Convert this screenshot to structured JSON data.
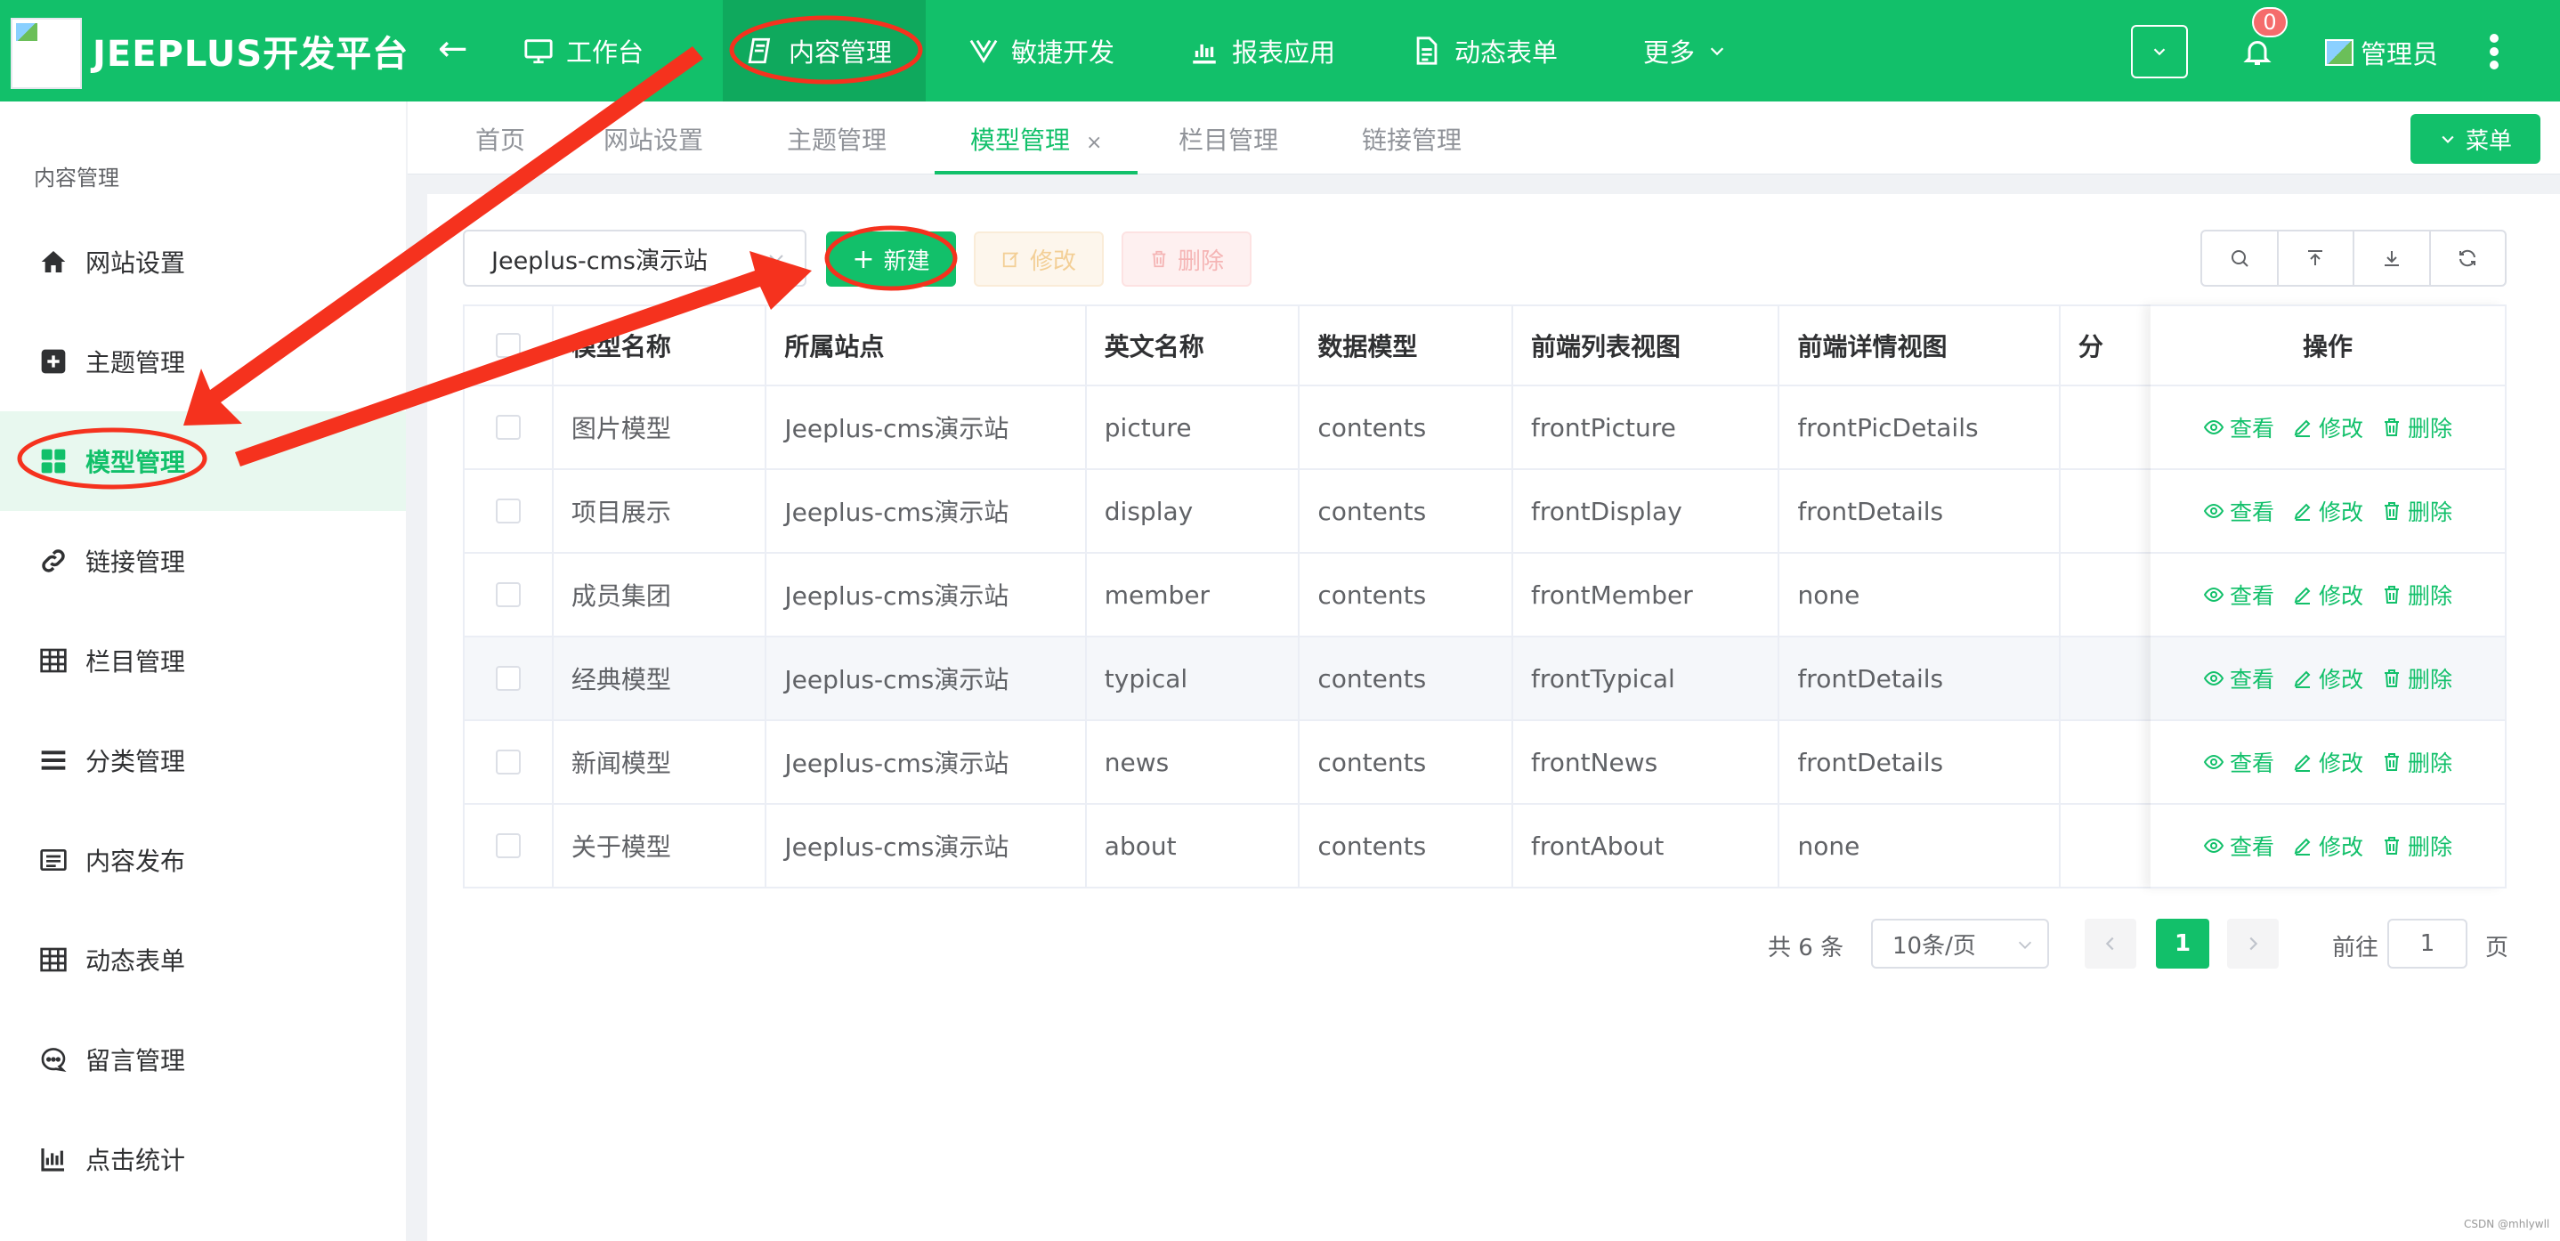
{
  "header": {
    "brand": "JEEPLUS开发平台",
    "nav": [
      {
        "label": "工作台"
      },
      {
        "label": "内容管理"
      },
      {
        "label": "敏捷开发"
      },
      {
        "label": "报表应用"
      },
      {
        "label": "动态表单"
      },
      {
        "label": "更多"
      }
    ],
    "notification_count": "0",
    "user_name": "管理员"
  },
  "sidebar": {
    "title": "内容管理",
    "items": [
      {
        "label": "网站设置",
        "icon": "home-icon"
      },
      {
        "label": "主题管理",
        "icon": "plus-square-icon"
      },
      {
        "label": "模型管理",
        "icon": "grid-icon"
      },
      {
        "label": "链接管理",
        "icon": "link-icon"
      },
      {
        "label": "栏目管理",
        "icon": "table-icon"
      },
      {
        "label": "分类管理",
        "icon": "list-icon"
      },
      {
        "label": "内容发布",
        "icon": "document-list-icon"
      },
      {
        "label": "动态表单",
        "icon": "table-icon"
      },
      {
        "label": "留言管理",
        "icon": "chat-icon"
      },
      {
        "label": "点击统计",
        "icon": "bar-chart-icon"
      }
    ]
  },
  "tabs": [
    {
      "label": "首页"
    },
    {
      "label": "网站设置"
    },
    {
      "label": "主题管理"
    },
    {
      "label": "模型管理"
    },
    {
      "label": "栏目管理"
    },
    {
      "label": "链接管理"
    }
  ],
  "tab_close": "×",
  "menu_button": "菜单",
  "toolbar": {
    "site_select": "Jeeplus-cms演示站",
    "new": "新建",
    "edit": "修改",
    "delete": "删除"
  },
  "table": {
    "columns": [
      "模型名称",
      "所属站点",
      "英文名称",
      "数据模型",
      "前端列表视图",
      "前端详情视图",
      "分"
    ],
    "ops_header": "操作",
    "ops": {
      "view": "查看",
      "edit": "修改",
      "delete": "删除"
    },
    "rows": [
      {
        "name": "图片模型",
        "site": "Jeeplus-cms演示站",
        "en": "picture",
        "model": "contents",
        "list_view": "frontPicture",
        "detail_view": "frontPicDetails"
      },
      {
        "name": "项目展示",
        "site": "Jeeplus-cms演示站",
        "en": "display",
        "model": "contents",
        "list_view": "frontDisplay",
        "detail_view": "frontDetails"
      },
      {
        "name": "成员集团",
        "site": "Jeeplus-cms演示站",
        "en": "member",
        "model": "contents",
        "list_view": "frontMember",
        "detail_view": "none"
      },
      {
        "name": "经典模型",
        "site": "Jeeplus-cms演示站",
        "en": "typical",
        "model": "contents",
        "list_view": "frontTypical",
        "detail_view": "frontDetails"
      },
      {
        "name": "新闻模型",
        "site": "Jeeplus-cms演示站",
        "en": "news",
        "model": "contents",
        "list_view": "frontNews",
        "detail_view": "frontDetails"
      },
      {
        "name": "关于模型",
        "site": "Jeeplus-cms演示站",
        "en": "about",
        "model": "contents",
        "list_view": "frontAbout",
        "detail_view": "none"
      }
    ]
  },
  "pagination": {
    "total": "共 6 条",
    "page_size": "10条/页",
    "current_page": "1",
    "goto_label": "前往",
    "goto_value": "1",
    "goto_suffix": "页"
  },
  "watermark": "CSDN @mhlywll",
  "colors": {
    "primary": "#12c06a",
    "annotation": "#f5321e"
  }
}
